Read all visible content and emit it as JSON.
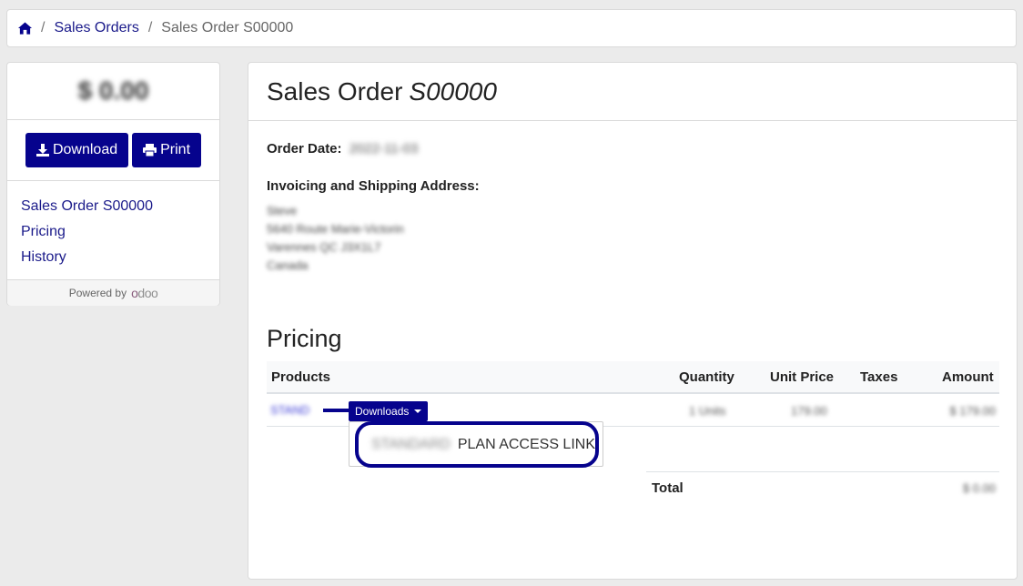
{
  "breadcrumb": {
    "home_icon": "home-icon",
    "items": [
      "Sales Orders",
      "Sales Order S00000"
    ],
    "separator": "/"
  },
  "sidebar": {
    "amount": "$ 0.00",
    "download_label": "Download",
    "print_label": "Print",
    "nav": [
      "Sales Order S00000",
      "Pricing",
      "History"
    ],
    "powered_by": "Powered by",
    "brand": "odoo"
  },
  "main": {
    "title_prefix": "Sales Order",
    "title_number": "S00000",
    "order_date_label": "Order Date:",
    "order_date_value": "2022-11-03",
    "address_label": "Invoicing and Shipping Address:",
    "address_lines": [
      "Steve",
      "5640 Route Marie-Victorin",
      "Varennes QC J3X1L7",
      "Canada"
    ],
    "pricing_title": "Pricing",
    "table": {
      "headers": {
        "products": "Products",
        "quantity": "Quantity",
        "unit_price": "Unit Price",
        "taxes": "Taxes",
        "amount": "Amount"
      },
      "row": {
        "product": "STAND",
        "downloads_label": "Downloads",
        "quantity": "1 Units",
        "unit_price": "179.00",
        "amount": "$ 179.00"
      }
    },
    "dropdown_item_prefix": "STANDARD",
    "dropdown_item": "PLAN ACCESS LINK",
    "total_label": "Total",
    "total_value": "$ 0.00"
  },
  "colors": {
    "primary": "#06038d",
    "link": "#1a1a8a",
    "highlight_ring": "#06038d"
  }
}
